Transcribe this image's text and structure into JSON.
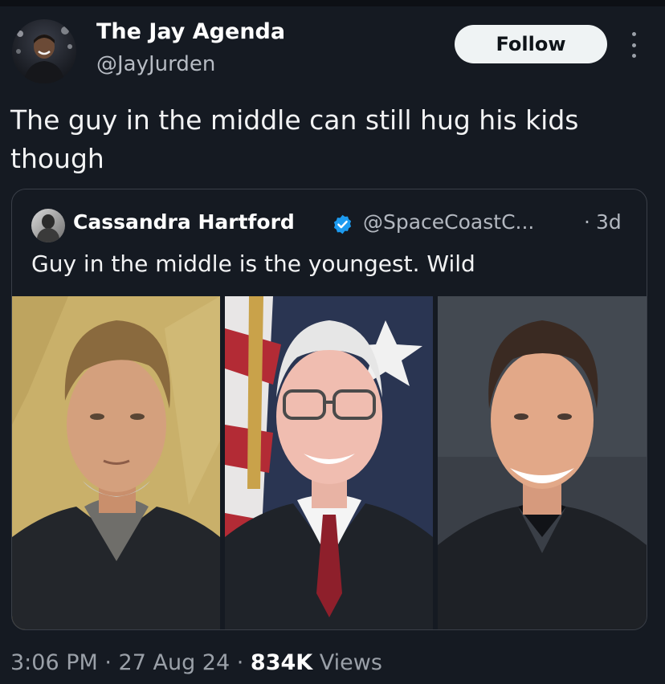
{
  "author": {
    "name": "The Jay Agenda",
    "handle": "@JayJurden",
    "avatar_icon": "profile-photo"
  },
  "follow_label": "Follow",
  "tweet_text": "The guy in the middle can still hug his kids though",
  "quoted": {
    "name": "Cassandra Hartford",
    "verified": true,
    "handle": "@SpaceCoastC...",
    "separator": "·",
    "time": "3d",
    "text": "Guy in the middle is the youngest. Wild",
    "photos": [
      "man-portrait-left",
      "man-portrait-middle",
      "man-portrait-right"
    ]
  },
  "footer": {
    "time": "3:06 PM",
    "sep1": " · ",
    "date": "27 Aug 24",
    "sep2": " · ",
    "views_count": "834K",
    "views_label": " Views"
  },
  "colors": {
    "background": "#151a22",
    "verified_blue": "#1d9bf0",
    "follow_bg": "#eff3f4"
  }
}
